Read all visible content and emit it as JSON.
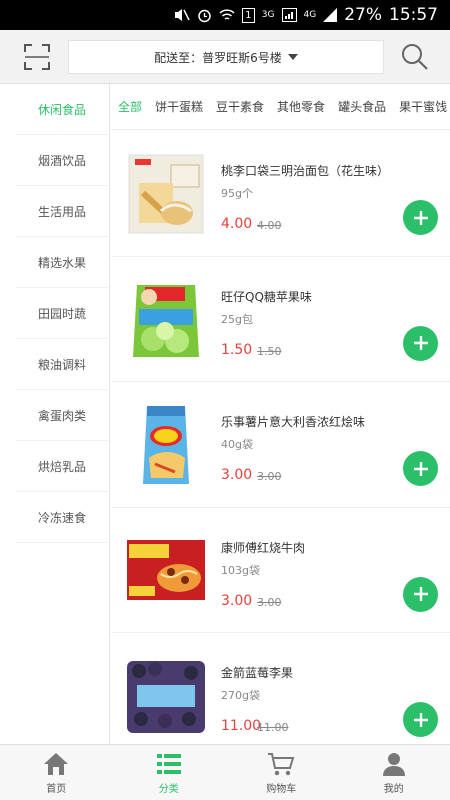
{
  "status_bar": {
    "network_1": "3G",
    "network_2": "4G",
    "sim_label": "1",
    "battery": "27%",
    "time": "15:57"
  },
  "header": {
    "address_text": "配送至：普罗旺斯6号楼",
    "icons": [
      "scan-icon",
      "search-icon",
      "chevron-down-icon"
    ]
  },
  "sidebar": {
    "items": [
      {
        "label": "休闲食品"
      },
      {
        "label": "烟酒饮品"
      },
      {
        "label": "生活用品"
      },
      {
        "label": "精选水果"
      },
      {
        "label": "田园时蔬"
      },
      {
        "label": "粮油调料"
      },
      {
        "label": "禽蛋肉类"
      },
      {
        "label": "烘焙乳品"
      },
      {
        "label": "冷冻速食"
      }
    ]
  },
  "tabs": [
    {
      "label": "全部"
    },
    {
      "label": "饼干蛋糕"
    },
    {
      "label": "豆干素食"
    },
    {
      "label": "其他零食"
    },
    {
      "label": "罐头食品"
    },
    {
      "label": "果干蜜饯"
    }
  ],
  "products": [
    {
      "name": "桃李口袋三明治面包（花生味）",
      "unit": "95g个",
      "price": "4.00",
      "original_price": "4.00"
    },
    {
      "name": "旺仔QQ糖苹果味",
      "unit": "25g包",
      "price": "1.50",
      "original_price": "1.50"
    },
    {
      "name": "乐事薯片意大利香浓红烩味",
      "unit": "40g袋",
      "price": "3.00",
      "original_price": "3.00"
    },
    {
      "name": "康师傅红烧牛肉",
      "unit": "103g袋",
      "price": "3.00",
      "original_price": "3.00"
    },
    {
      "name": "金箭蓝莓李果",
      "unit": "270g袋",
      "price": "11.00",
      "original_price": "11.00"
    }
  ],
  "bottom_nav": {
    "items": [
      {
        "label": "首页",
        "icon": "home-icon"
      },
      {
        "label": "分类",
        "icon": "list-icon"
      },
      {
        "label": "购物车",
        "icon": "cart-icon"
      },
      {
        "label": "我的",
        "icon": "user-icon"
      }
    ]
  },
  "colors": {
    "accent": "#2bbf6a",
    "price": "#e8403a",
    "header_bg": "#f2f2f2"
  }
}
